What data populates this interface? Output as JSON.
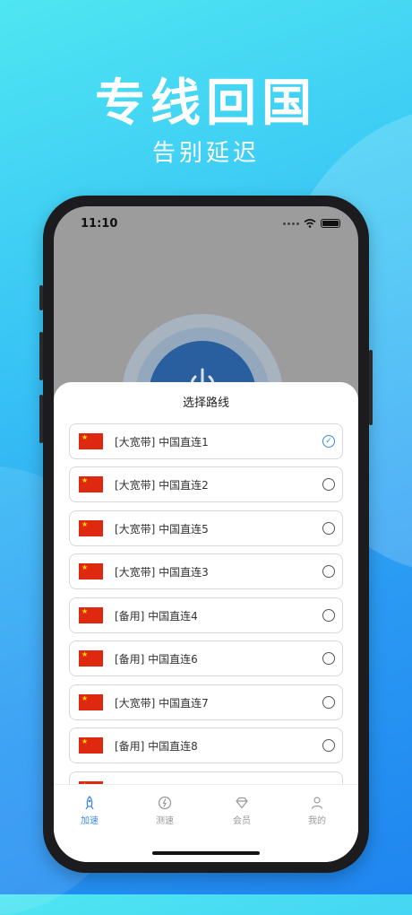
{
  "hero": {
    "title": "专线回国",
    "subtitle": "告别延迟"
  },
  "status": {
    "time": "11:10"
  },
  "sheet": {
    "title": "选择路线"
  },
  "routes": [
    {
      "label": "[大宽带] 中国直连1",
      "selected": true
    },
    {
      "label": "[大宽带] 中国直连2",
      "selected": false
    },
    {
      "label": "[大宽带] 中国直连5",
      "selected": false
    },
    {
      "label": "[大宽带] 中国直连3",
      "selected": false
    },
    {
      "label": "[备用] 中国直连4",
      "selected": false
    },
    {
      "label": "[备用] 中国直连6",
      "selected": false
    },
    {
      "label": "[大宽带] 中国直连7",
      "selected": false
    },
    {
      "label": "[备用] 中国直连8",
      "selected": false
    }
  ],
  "tabs": [
    {
      "label": "加速",
      "icon": "rocket-icon",
      "active": true
    },
    {
      "label": "测速",
      "icon": "speedometer-icon",
      "active": false
    },
    {
      "label": "会员",
      "icon": "diamond-icon",
      "active": false
    },
    {
      "label": "我的",
      "icon": "user-icon",
      "active": false
    }
  ],
  "colors": {
    "accent": "#3f8ae0",
    "flag_red": "#de2910",
    "flag_yellow": "#ffde00"
  }
}
